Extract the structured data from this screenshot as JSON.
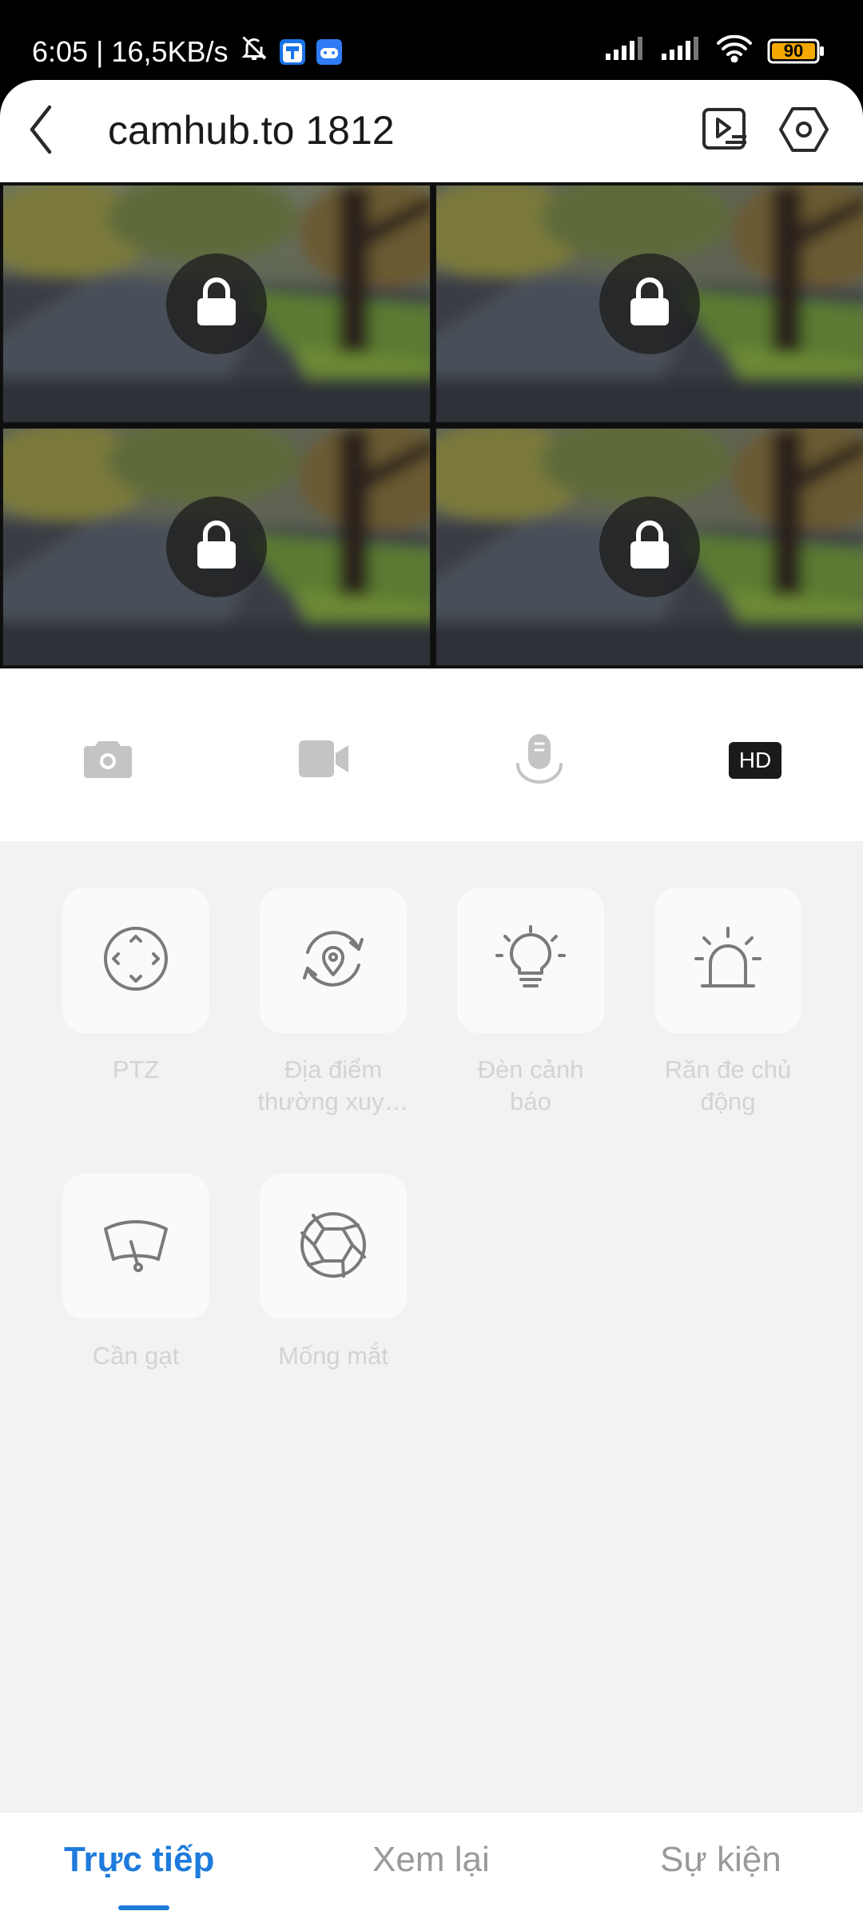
{
  "status_bar": {
    "time_speed": "6:05 | 16,5KB/s",
    "battery": "90",
    "icons": [
      "bell-off-icon",
      "app-icon",
      "gamepad-icon",
      "signal-icon",
      "signal-icon",
      "wifi-icon",
      "battery-icon"
    ]
  },
  "header": {
    "title": "camhub.to 1812",
    "icons": [
      "back-icon",
      "playback-list-icon",
      "settings-hex-icon"
    ]
  },
  "video_grid": {
    "cells": [
      {
        "state": "locked"
      },
      {
        "state": "locked"
      },
      {
        "state": "locked"
      },
      {
        "state": "locked"
      }
    ]
  },
  "controls": {
    "items": [
      "camera-icon",
      "video-icon",
      "microphone-icon"
    ],
    "hd_label": "HD"
  },
  "features": {
    "ptz": "PTZ",
    "preset": "Địa điểm thường xuy…",
    "light": "Đèn cảnh báo",
    "siren": "Răn đe chủ động",
    "wiper": "Cần gạt",
    "iris": "Mống mắt"
  },
  "tabs": {
    "live": "Trực tiếp",
    "playback": "Xem lại",
    "events": "Sự kiện",
    "active": "live"
  },
  "colors": {
    "accent": "#1e7bdc",
    "panel_bg": "#f2f2f2",
    "icon_gray": "#7a7a7a",
    "label_disabled": "#d3d3d3"
  }
}
